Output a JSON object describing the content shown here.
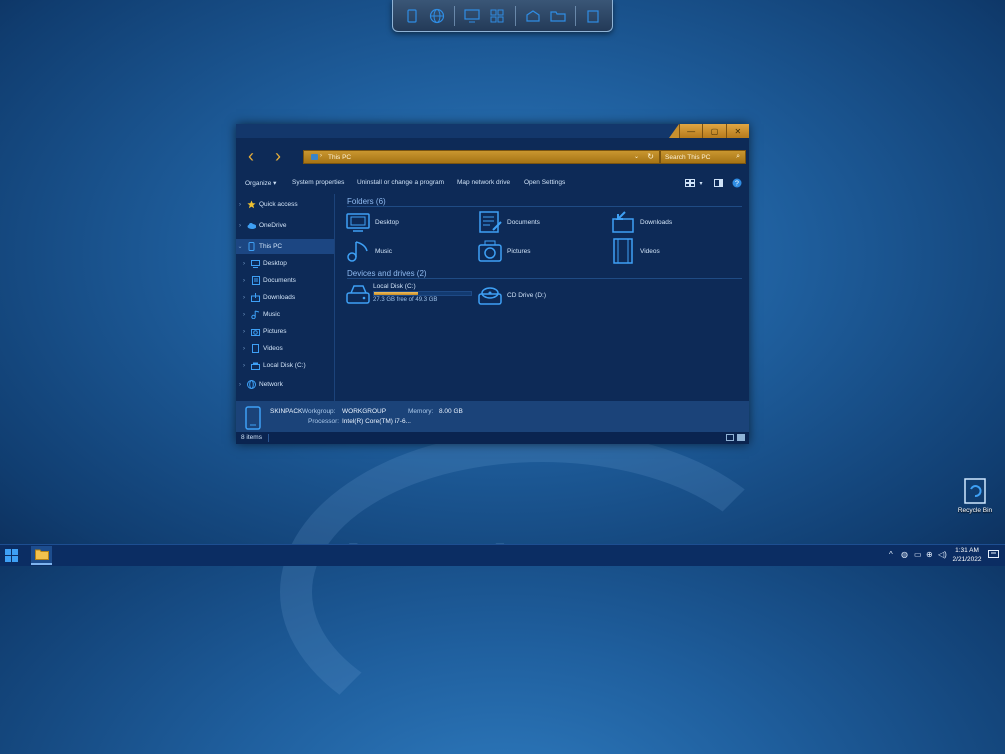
{
  "window": {
    "address": "This PC",
    "search_placeholder": "Search This PC",
    "controls": {
      "minimize": "—",
      "maximize": "▢",
      "close": "✕"
    }
  },
  "commands": {
    "organize": "Organize ▾",
    "system_properties": "System properties",
    "uninstall": "Uninstall or change a program",
    "map_drive": "Map network drive",
    "open_settings": "Open Settings"
  },
  "sidebar": {
    "items": [
      {
        "label": "Quick access",
        "icon": "star-icon"
      },
      {
        "label": "OneDrive",
        "icon": "cloud-icon"
      },
      {
        "label": "This PC",
        "icon": "computer-icon"
      },
      {
        "label": "Desktop",
        "icon": "desktop-icon"
      },
      {
        "label": "Documents",
        "icon": "documents-icon"
      },
      {
        "label": "Downloads",
        "icon": "downloads-icon"
      },
      {
        "label": "Music",
        "icon": "music-icon"
      },
      {
        "label": "Pictures",
        "icon": "pictures-icon"
      },
      {
        "label": "Videos",
        "icon": "videos-icon"
      },
      {
        "label": "Local Disk (C:)",
        "icon": "drive-icon"
      },
      {
        "label": "Network",
        "icon": "network-icon"
      }
    ]
  },
  "content": {
    "folders_title": "Folders (6)",
    "folders": [
      {
        "label": "Desktop"
      },
      {
        "label": "Documents"
      },
      {
        "label": "Downloads"
      },
      {
        "label": "Music"
      },
      {
        "label": "Pictures"
      },
      {
        "label": "Videos"
      }
    ],
    "drives_title": "Devices and drives (2)",
    "drives": [
      {
        "label": "Local Disk (C:)",
        "free": "27.3 GB free of 49.3 GB",
        "used_fraction": 0.45
      },
      {
        "label": "CD Drive (D:)"
      }
    ]
  },
  "details": {
    "name": "SKINPACK",
    "workgroup_label": "Workgroup:",
    "workgroup": "WORKGROUP",
    "memory_label": "Memory:",
    "memory": "8.00 GB",
    "processor_label": "Processor:",
    "processor": "Intel(R) Core(TM) i7-6..."
  },
  "status": {
    "items": "8 items"
  },
  "desktop": {
    "recycle_bin": "Recycle Bin"
  },
  "taskbar": {
    "time": "1:31 AM",
    "date": "2/21/2022"
  },
  "colors": {
    "accent": "#d9a03a",
    "window_bg": "#0d2a57",
    "icon": "#3ea0f5"
  }
}
